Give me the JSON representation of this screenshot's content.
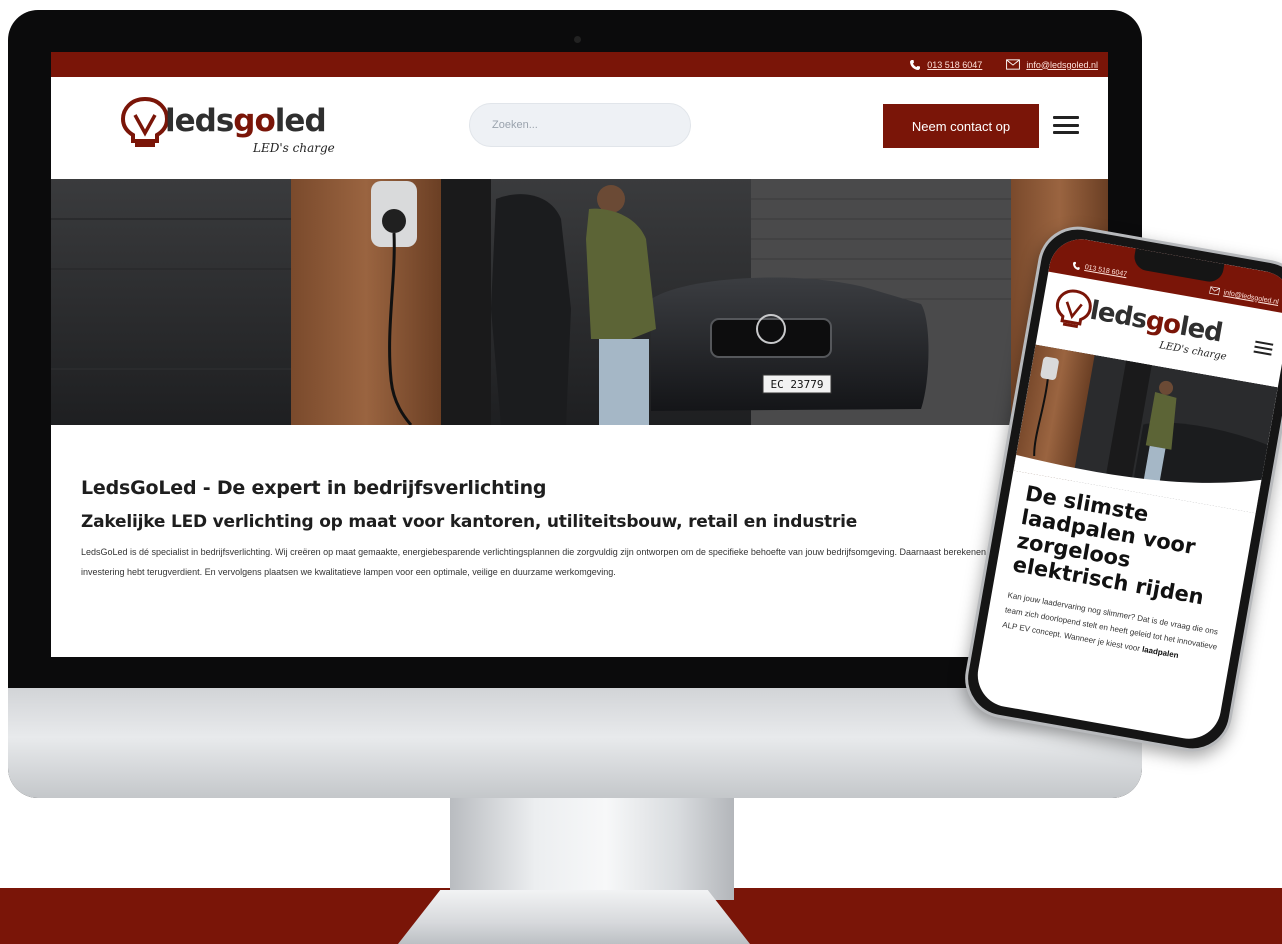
{
  "brand": {
    "name_part1": "leds",
    "name_part2": "go",
    "name_part3": "led",
    "tagline": "LED's charge",
    "color": "#7a1508"
  },
  "desktop": {
    "topbar": {
      "phone_icon": "phone-icon",
      "phone": "013 518 6047",
      "mail_icon": "mail-icon",
      "email": "info@ledsgoled.nl"
    },
    "header": {
      "search_placeholder": "Zoeken...",
      "cta_label": "Neem contact op",
      "menu_icon": "hamburger-icon"
    },
    "hero": {
      "plate": "EC 23779"
    },
    "content": {
      "h1": "LedsGoLed - De expert in bedrijfsverlichting",
      "h2": "Zakelijke LED verlichting op maat voor kantoren, utiliteitsbouw, retail en industrie",
      "paragraph": "LedsGoLed is dé specialist in bedrijfsverlichting. Wij creëren op maat gemaakte, energiebesparende verlichtingsplannen die zorgvuldig zijn ontworpen om de specifieke behoefte van jouw bedrijfsomgeving. Daarnaast berekenen we hoe snel je je investering hebt terugverdient. En vervolgens plaatsen we kwalitatieve lampen voor een optimale, veilige en duurzame werkomgeving."
    }
  },
  "mobile": {
    "topbar": {
      "phone": "013 518 6047",
      "email": "info@ledsgoled.nl"
    },
    "title": "De slimste laadpalen voor zorgeloos elektrisch rijden",
    "paragraph_start": "Kan jouw laadervaring nog slimmer? Dat is de vraag die ons team zich doorlopend stelt en heeft geleid tot het innovatieve ALP EV concept. Wanneer je kiest voor ",
    "paragraph_bold": "laadpalen"
  }
}
